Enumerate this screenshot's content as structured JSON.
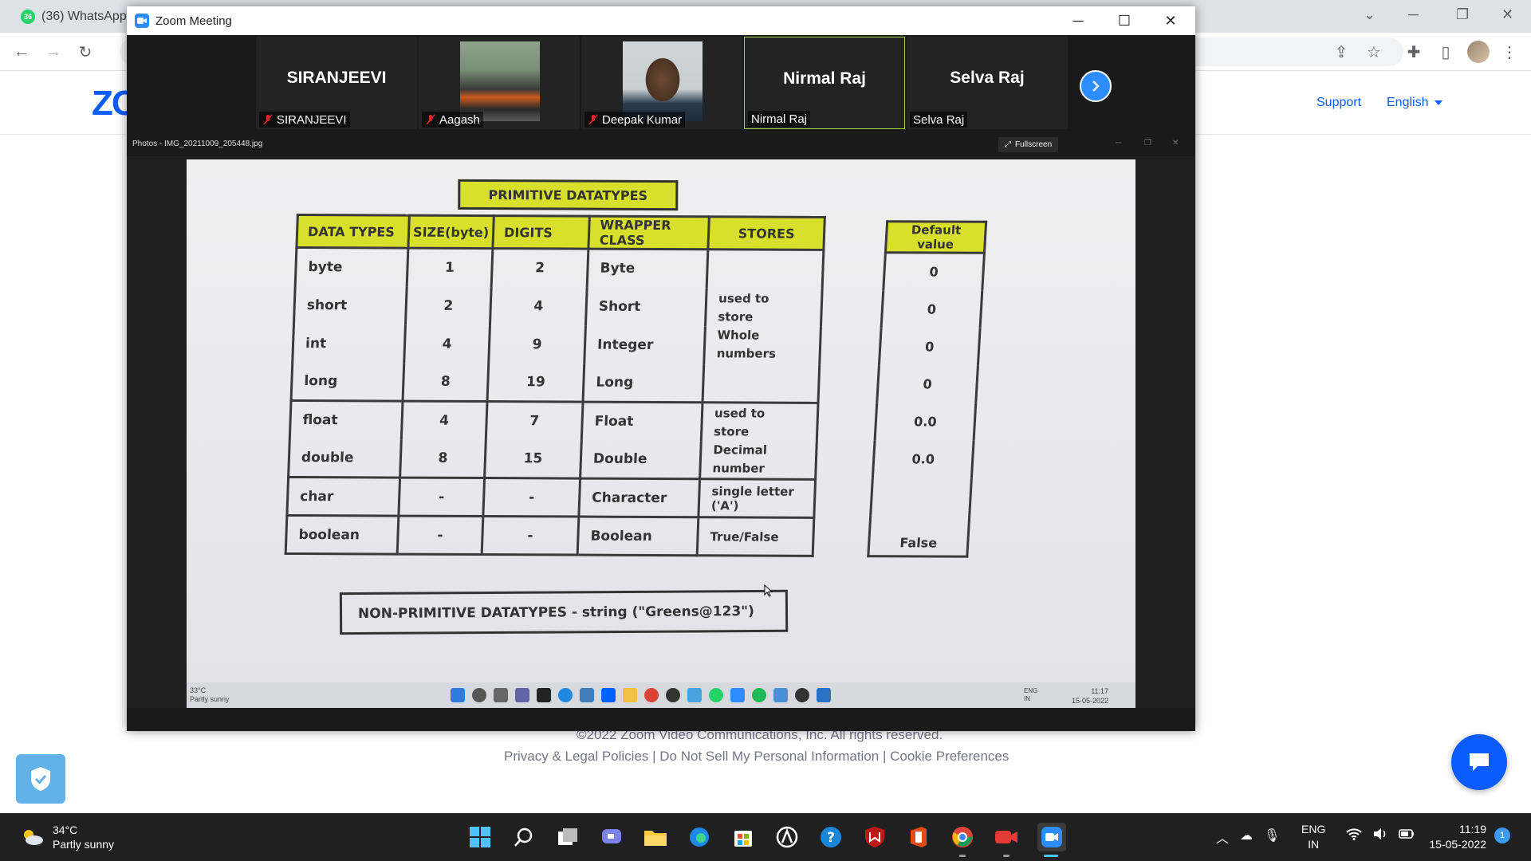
{
  "browser": {
    "tab_title": "(36) WhatsApp",
    "tab_badge": "36"
  },
  "website": {
    "logo_text": "ZO",
    "nav": {
      "support": "Support",
      "language": "English"
    },
    "footer": {
      "copyright": "©2022 Zoom Video Communications, Inc. All rights reserved.",
      "links": "Privacy & Legal Policies | Do Not Sell My Personal Information | Cookie Preferences"
    }
  },
  "zoom_window": {
    "title": "Zoom Meeting",
    "participants": [
      {
        "name": "SIRANJEEVI",
        "label": "SIRANJEEVI",
        "muted": true,
        "has_photo": false
      },
      {
        "name": "Aagash",
        "label": "Aagash",
        "muted": true,
        "has_photo": true
      },
      {
        "name": "Deepak Kumar",
        "label": "Deepak Kumar",
        "muted": true,
        "has_photo": true
      },
      {
        "name": "Nirmal Raj",
        "label": "Nirmal Raj",
        "muted": false,
        "has_photo": false,
        "active": true
      },
      {
        "name": "Selva Raj",
        "label": "Selva Raj",
        "muted": false,
        "has_photo": false
      }
    ],
    "share": {
      "file_name": "Photos - IMG_20211009_205448.jpg",
      "fullscreen_label": "Fullscreen"
    }
  },
  "whiteboard": {
    "title": "PRIMITIVE DATATYPES",
    "headers": [
      "DATA TYPES",
      "SIZE(byte)",
      "DIGITS",
      "WRAPPER CLASS",
      "STORES"
    ],
    "rows": [
      {
        "type": "byte",
        "size": "1",
        "digits": "2",
        "wrapper": "Byte"
      },
      {
        "type": "short",
        "size": "2",
        "digits": "4",
        "wrapper": "Short"
      },
      {
        "type": "int",
        "size": "4",
        "digits": "9",
        "wrapper": "Integer"
      },
      {
        "type": "long",
        "size": "8",
        "digits": "19",
        "wrapper": "Long"
      },
      {
        "type": "float",
        "size": "4",
        "digits": "7",
        "wrapper": "Float"
      },
      {
        "type": "double",
        "size": "8",
        "digits": "15",
        "wrapper": "Double"
      },
      {
        "type": "char",
        "size": "-",
        "digits": "-",
        "wrapper": "Character"
      },
      {
        "type": "boolean",
        "size": "-",
        "digits": "-",
        "wrapper": "Boolean"
      }
    ],
    "stores": {
      "whole_l1": "used to",
      "whole_l2": "store",
      "whole_l3": "Whole numbers",
      "decimal_l1": "used to",
      "decimal_l2": "store",
      "decimal_l3": "Decimal number",
      "char": "single letter ('A')",
      "boolean": "True/False"
    },
    "default_header": "Default value",
    "defaults": [
      "0",
      "0",
      "0",
      "0",
      "0.0",
      "0.0",
      "",
      "False"
    ],
    "non_primitive": "NON-PRIMITIVE DATATYPES   - string (\"Greens@123\")"
  },
  "shared_taskbar": {
    "temp": "33°C",
    "condition": "Partly sunny",
    "lang_l1": "ENG",
    "lang_l2": "IN",
    "time": "11:17",
    "date": "15-05-2022"
  },
  "taskbar": {
    "temp": "34°C",
    "condition": "Partly sunny",
    "lang_l1": "ENG",
    "lang_l2": "IN",
    "time": "11:19",
    "date": "15-05-2022",
    "notification_count": "1"
  }
}
